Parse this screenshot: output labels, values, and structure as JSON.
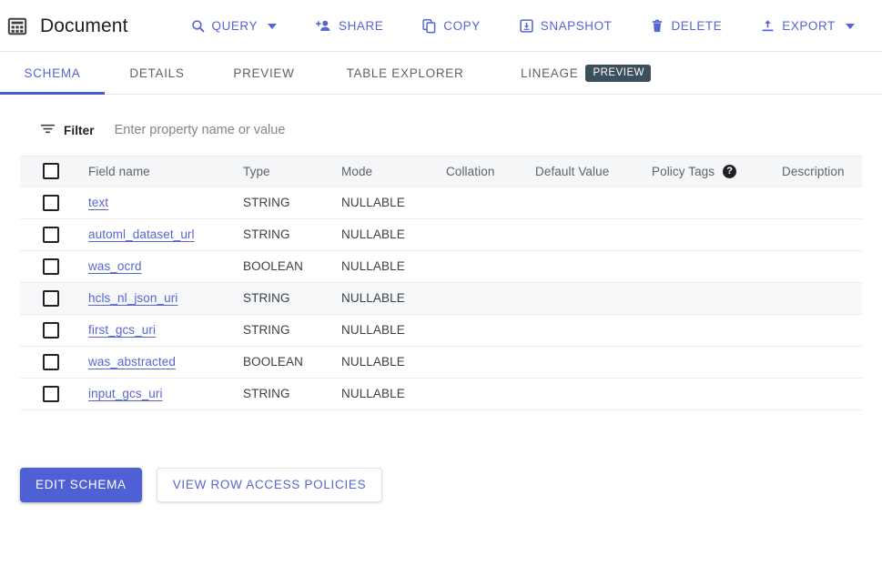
{
  "header": {
    "table_icon": "table-grid-icon",
    "title": "Document",
    "actions": [
      {
        "icon": "search-icon",
        "label": "QUERY",
        "has_caret": true
      },
      {
        "icon": "person-add-icon",
        "label": "SHARE",
        "has_caret": false
      },
      {
        "icon": "copy-icon",
        "label": "COPY",
        "has_caret": false
      },
      {
        "icon": "snapshot-icon",
        "label": "SNAPSHOT",
        "has_caret": false
      },
      {
        "icon": "trash-icon",
        "label": "DELETE",
        "has_caret": false
      },
      {
        "icon": "export-icon",
        "label": "EXPORT",
        "has_caret": true
      }
    ]
  },
  "tabs": {
    "items": [
      {
        "label": "SCHEMA",
        "active": true,
        "badge": null
      },
      {
        "label": "DETAILS",
        "active": false,
        "badge": null
      },
      {
        "label": "PREVIEW",
        "active": false,
        "badge": null
      },
      {
        "label": "TABLE EXPLORER",
        "active": false,
        "badge": null
      },
      {
        "label": "LINEAGE",
        "active": false,
        "badge": "PREVIEW"
      }
    ]
  },
  "filter": {
    "icon": "filter-icon",
    "label": "Filter",
    "value": "",
    "placeholder": "Enter property name or value"
  },
  "table": {
    "columns": [
      "Field name",
      "Type",
      "Mode",
      "Collation",
      "Default Value",
      "Policy Tags",
      "Description"
    ],
    "policy_tags_help_icon": "help-icon",
    "policy_tags_help_glyph": "?",
    "rows": [
      {
        "field": "text",
        "type": "STRING",
        "mode": "NULLABLE",
        "collation": "",
        "default_value": "",
        "policy_tags": "",
        "description": "",
        "highlighted": false
      },
      {
        "field": "automl_dataset_url",
        "type": "STRING",
        "mode": "NULLABLE",
        "collation": "",
        "default_value": "",
        "policy_tags": "",
        "description": "",
        "highlighted": false
      },
      {
        "field": "was_ocrd",
        "type": "BOOLEAN",
        "mode": "NULLABLE",
        "collation": "",
        "default_value": "",
        "policy_tags": "",
        "description": "",
        "highlighted": false
      },
      {
        "field": "hcls_nl_json_uri",
        "type": "STRING",
        "mode": "NULLABLE",
        "collation": "",
        "default_value": "",
        "policy_tags": "",
        "description": "",
        "highlighted": true
      },
      {
        "field": "first_gcs_uri",
        "type": "STRING",
        "mode": "NULLABLE",
        "collation": "",
        "default_value": "",
        "policy_tags": "",
        "description": "",
        "highlighted": false
      },
      {
        "field": "was_abstracted",
        "type": "BOOLEAN",
        "mode": "NULLABLE",
        "collation": "",
        "default_value": "",
        "policy_tags": "",
        "description": "",
        "highlighted": false
      },
      {
        "field": "input_gcs_uri",
        "type": "STRING",
        "mode": "NULLABLE",
        "collation": "",
        "default_value": "",
        "policy_tags": "",
        "description": "",
        "highlighted": false
      }
    ]
  },
  "footer": {
    "edit_schema_label": "EDIT SCHEMA",
    "view_policies_label": "VIEW ROW ACCESS POLICIES"
  },
  "colors": {
    "accent": "#5566d4",
    "primary_button": "#4f5fd4",
    "tab_indicator": "#4758d1",
    "badge_bg": "#3c4f5c",
    "header_row_bg": "#f5f6f7",
    "row_hover_bg": "#f6f7f8",
    "divider": "#e8eaed",
    "text_primary": "#202124",
    "text_secondary": "#5f6368"
  }
}
